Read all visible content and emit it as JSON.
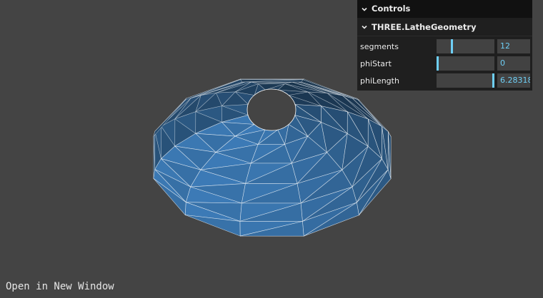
{
  "gui": {
    "title": "Controls",
    "folder_title": "THREE.LatheGeometry",
    "controls": [
      {
        "label": "segments",
        "value": "12",
        "level": 0.25
      },
      {
        "label": "phiStart",
        "value": "0",
        "level": 0.0
      },
      {
        "label": "phiLength",
        "value": "6.28318",
        "level": 1.0
      }
    ]
  },
  "footer": {
    "open_link": "Open in New Window"
  },
  "colors": {
    "background": "#444444",
    "mesh_fill": "#3d7cb8",
    "wireframe": "#ffffff",
    "accent": "#6ecff6"
  },
  "icons": {
    "collapse": "chevron-down-icon"
  }
}
